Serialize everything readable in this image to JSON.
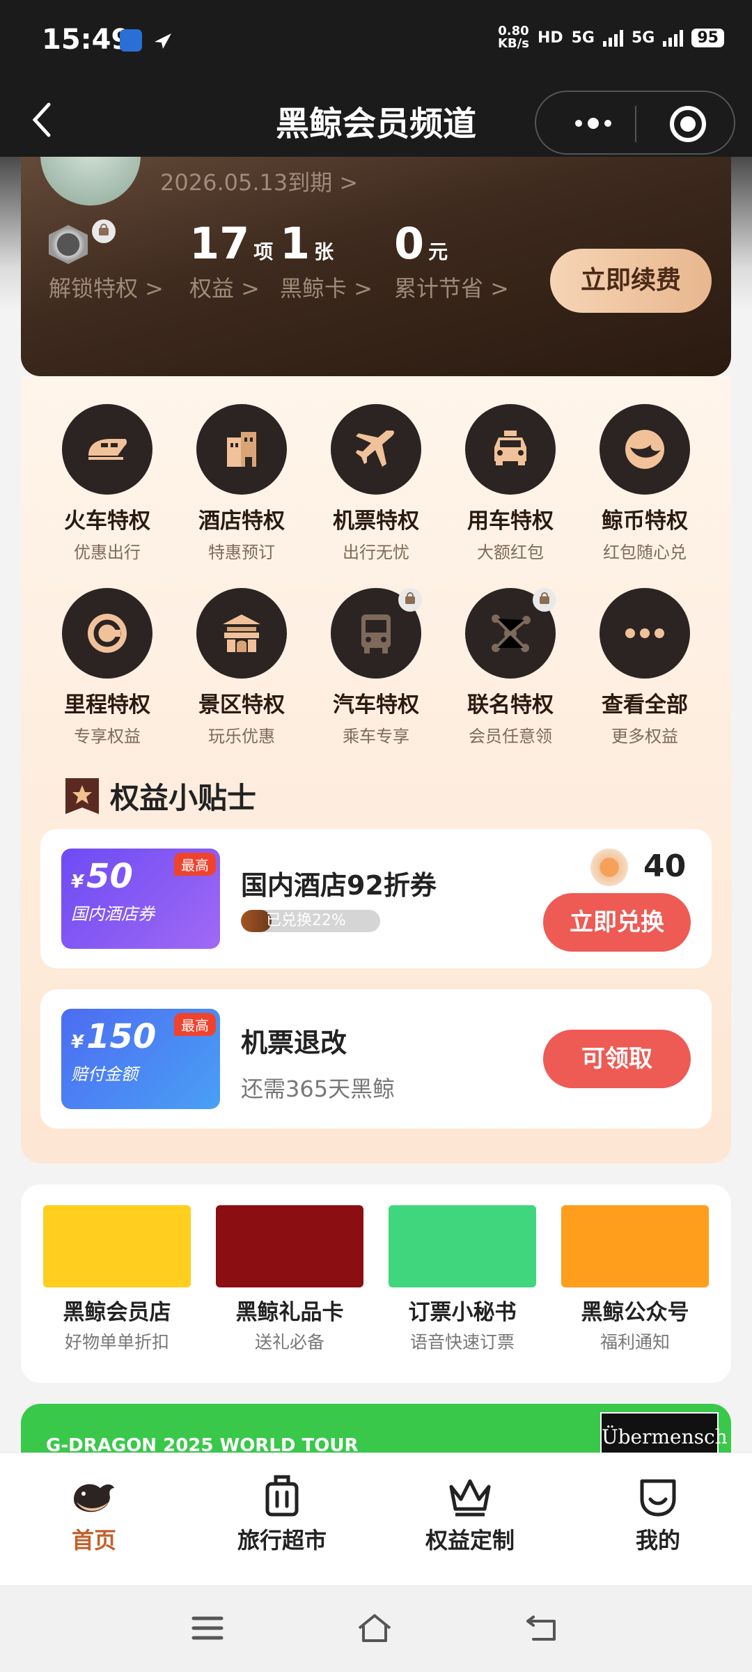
{
  "status_bar": {
    "time": "15:49",
    "net_speed_value": "0.80",
    "net_speed_unit": "KB/s",
    "hd": "HD",
    "network_1": "5G",
    "network_2": "5G",
    "battery": "95"
  },
  "nav": {
    "title": "黑鲸会员频道"
  },
  "member": {
    "expiry": "2026.05.13到期 >",
    "unlock_label": "解锁特权 >",
    "stats": [
      {
        "num": "17",
        "unit": "项",
        "label": "权益 >"
      },
      {
        "num": "1",
        "unit": "张",
        "label": "黑鲸卡 >"
      },
      {
        "num": "0",
        "unit": "元",
        "label": "累计节省 >"
      }
    ],
    "renew_button": "立即续费"
  },
  "privileges": [
    {
      "title": "火车特权",
      "sub": "优惠出行",
      "icon": "train-icon",
      "locked": false
    },
    {
      "title": "酒店特权",
      "sub": "特惠预订",
      "icon": "hotel-icon",
      "locked": false
    },
    {
      "title": "机票特权",
      "sub": "出行无忧",
      "icon": "airplane-icon",
      "locked": false
    },
    {
      "title": "用车特权",
      "sub": "大额红包",
      "icon": "taxi-icon",
      "locked": false
    },
    {
      "title": "鲸币特权",
      "sub": "红包随心兑",
      "icon": "whale-coin-icon",
      "locked": false
    },
    {
      "title": "里程特权",
      "sub": "专享权益",
      "icon": "mileage-icon",
      "locked": false
    },
    {
      "title": "景区特权",
      "sub": "玩乐优惠",
      "icon": "scenic-gate-icon",
      "locked": false
    },
    {
      "title": "汽车特权",
      "sub": "乘车专享",
      "icon": "bus-icon",
      "locked": true
    },
    {
      "title": "联名特权",
      "sub": "会员任意领",
      "icon": "network-icon",
      "locked": true
    },
    {
      "title": "查看全部",
      "sub": "更多权益",
      "icon": "more-icon",
      "locked": false
    }
  ],
  "tips": {
    "title": "权益小贴士",
    "cards": [
      {
        "coupon_currency": "¥",
        "coupon_amount": "50",
        "coupon_desc": "国内酒店券",
        "coupon_tag": "最高",
        "title": "国内酒店92折券",
        "progress_text": "已兑换22%",
        "progress": 0.22,
        "coin_cost": "40",
        "button": "立即兑换"
      },
      {
        "coupon_currency": "¥",
        "coupon_amount": "150",
        "coupon_desc": "赔付金额",
        "coupon_tag": "最高",
        "title": "机票退改",
        "sub": "还需365天黑鲸",
        "button": "可领取"
      }
    ]
  },
  "services": [
    {
      "title": "黑鲸会员店",
      "sub": "好物单单折扣",
      "color": "#ffce1f"
    },
    {
      "title": "黑鲸礼品卡",
      "sub": "送礼必备",
      "color": "#8a0e12"
    },
    {
      "title": "订票小秘书",
      "sub": "语音快速订票",
      "color": "#3fd67e"
    },
    {
      "title": "黑鲸公众号",
      "sub": "福利通知",
      "color": "#ff9d1c"
    }
  ],
  "banner": {
    "text": "G-DRAGON 2025 WORLD TOUR",
    "logo": "Übermensch"
  },
  "tabs": [
    {
      "label": "首页",
      "icon": "whale-home-icon",
      "active": true
    },
    {
      "label": "旅行超市",
      "icon": "suitcase-icon",
      "active": false
    },
    {
      "label": "权益定制",
      "icon": "crown-icon",
      "active": false
    },
    {
      "label": "我的",
      "icon": "smile-profile-icon",
      "active": false
    }
  ],
  "colors": {
    "accent": "#c2602c",
    "red_button": "#ee5a54",
    "card_dark": "#3e2a1e",
    "banner_green": "#39c84a"
  }
}
